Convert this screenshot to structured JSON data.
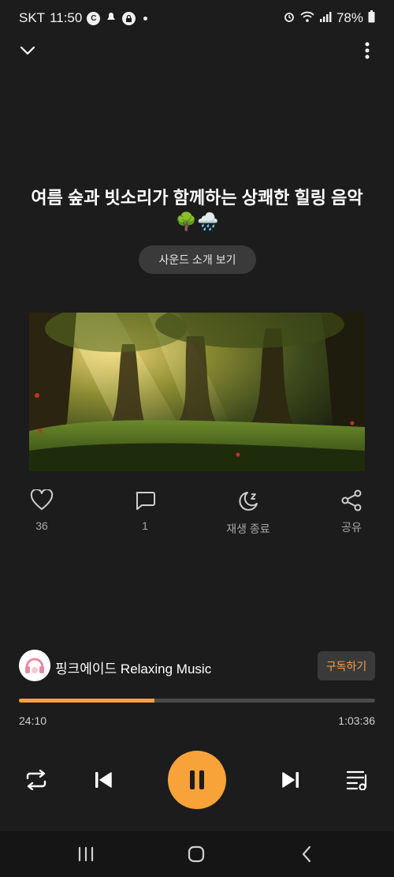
{
  "status_bar": {
    "carrier": "SKT",
    "time": "11:50",
    "battery": "78%"
  },
  "header": {
    "collapse_icon": "chevron-down-icon",
    "menu_icon": "more-vert-icon"
  },
  "track": {
    "title": "여름 숲과 빗소리가 함께하는 상쾌한 힐링 음악🌳🌧️",
    "intro_button": "사운드 소개 보기"
  },
  "actions": {
    "like_count": "36",
    "comment_count": "1",
    "sleep_timer_label": "재생 종료",
    "share_label": "공유"
  },
  "channel": {
    "name": "핑크에이드 Relaxing Music",
    "subscribe_label": "구독하기"
  },
  "playback": {
    "elapsed": "24:10",
    "duration": "1:03:36",
    "progress_fraction": 0.38
  },
  "colors": {
    "accent": "#f7a33a",
    "background": "#1c1c1c"
  }
}
